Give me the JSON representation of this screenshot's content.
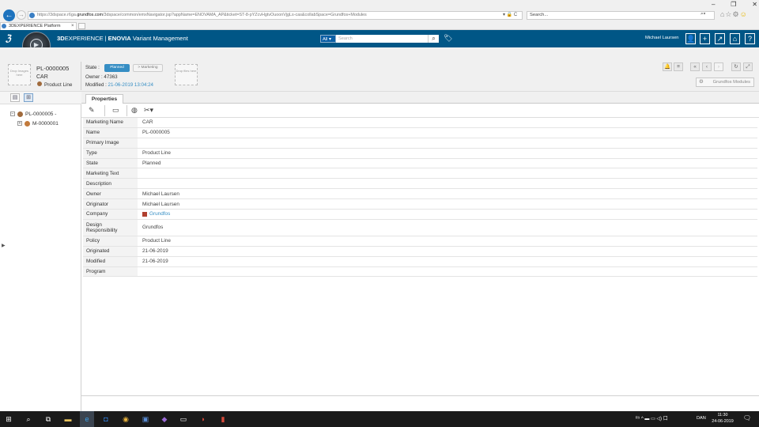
{
  "browser": {
    "url_prefix": "https://3dspace.r6ga.",
    "url_host": "grundfos.com",
    "url_rest": "/3dspace/common/emxNavigator.jsp?appName=ENOVAMA_AP&ticket=ST-8-pYZcvHgtvOuoonVjgLs-cas&collabSpace=Grundfos+Modules",
    "url_controls": "▾ 🔒 C",
    "search_placeholder": "Search...",
    "search_icon": "⌕▾",
    "tab_title": "3DEXPERIENCE Platform",
    "tab_close": "×",
    "window_controls": [
      "–",
      "❐",
      "✕"
    ],
    "toolbar_icons": "⌂☆⚙"
  },
  "app": {
    "brand_bold": "3D",
    "brand_experience": "EXPERIENCE",
    "brand_sep": "|",
    "brand_enovia": "ENOVIA",
    "brand_app": "Variant Management",
    "all_label": "All ▾",
    "search_placeholder": "Search",
    "user_name": "Michael Laursen"
  },
  "header": {
    "drop_images": "Drop Images here",
    "drop_files": "Drop files here",
    "name": "PL-0000005",
    "title": "CAR",
    "type": "Product Line",
    "state_label": "State :",
    "state_current": "Planned",
    "state_next": "> Marketing",
    "owner": "Owner : 47363",
    "modified_label": "Modified : ",
    "modified_value": "21-06-2019 13:04:24",
    "modules_button": "Grundfos Modules"
  },
  "tree": {
    "root_label": "PL-0000005 -",
    "child_label": "M-0000001"
  },
  "tabs": {
    "properties": "Properties"
  },
  "properties": [
    {
      "label": "Marketing Name",
      "value": "CAR"
    },
    {
      "label": "Name",
      "value": "PL-0000005"
    },
    {
      "label": "Primary Image",
      "value": ""
    },
    {
      "label": "Type",
      "value": "Product Line"
    },
    {
      "label": "State",
      "value": "Planned"
    },
    {
      "label": "Marketing Text",
      "value": ""
    },
    {
      "label": "Description",
      "value": ""
    },
    {
      "label": "Owner",
      "value": "Michael Laursen"
    },
    {
      "label": "Originator",
      "value": "Michael Laursen"
    },
    {
      "label": "Company",
      "value": "Grundfos"
    },
    {
      "label": "Design Responsibility",
      "value": "Grundfos"
    },
    {
      "label": "Policy",
      "value": "Product Line"
    },
    {
      "label": "Originated",
      "value": "21-06-2019"
    },
    {
      "label": "Modified",
      "value": "21-06-2019"
    },
    {
      "label": "Program",
      "value": ""
    }
  ],
  "taskbar": {
    "tray": "ᴿ⁹  ^  ▬  ▭  ◁)  口",
    "language": "DAN",
    "time": "11:30",
    "date": "24-06-2019",
    "notification_count": "3"
  },
  "colors": {
    "app_bar": "#005686",
    "accent": "#368ec4"
  }
}
